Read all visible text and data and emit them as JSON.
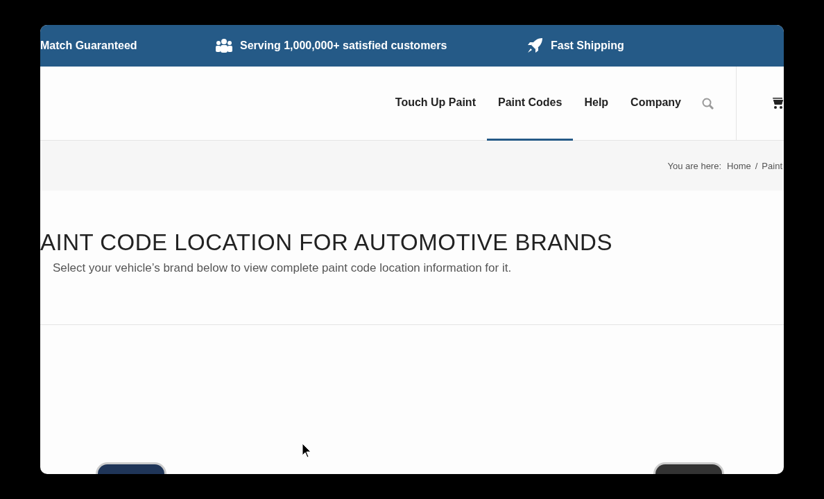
{
  "top_bar": {
    "items": [
      {
        "kind": "text",
        "label": "Match Guaranteed"
      },
      {
        "kind": "people",
        "label": "Serving 1,000,000+ satisfied customers"
      },
      {
        "kind": "rocket",
        "label": "Fast Shipping"
      }
    ]
  },
  "nav": {
    "items": [
      {
        "label": "Touch Up Paint",
        "selected": false
      },
      {
        "label": "Paint Codes",
        "selected": true
      },
      {
        "label": "Help",
        "selected": false
      },
      {
        "label": "Company",
        "selected": false
      }
    ]
  },
  "breadcrumb": {
    "prefix": "You are here:",
    "items": [
      "Home",
      "Paint"
    ],
    "separator": "/"
  },
  "page": {
    "title": "AINT CODE LOCATION FOR AUTOMOTIVE BRANDS",
    "subtitle": "Select your vehicle’s brand below to view complete paint code location information for it."
  }
}
